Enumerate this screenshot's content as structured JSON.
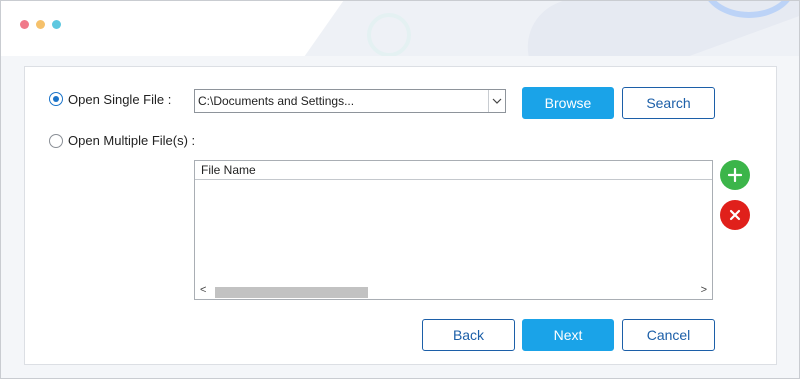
{
  "window": {
    "dots": [
      {
        "name": "close-dot",
        "color": "#f07a8a"
      },
      {
        "name": "minimize-dot",
        "color": "#f5c16b"
      },
      {
        "name": "maximize-dot",
        "color": "#5ec8e0"
      }
    ]
  },
  "single": {
    "label": "Open Single File :",
    "selected": true,
    "path_value": "C:\\Documents and Settings...",
    "browse_label": "Browse",
    "search_label": "Search"
  },
  "multiple": {
    "label": "Open Multiple File(s) :",
    "selected": false,
    "list": {
      "columns": [
        "File Name"
      ],
      "rows": [],
      "scroll_left": "<",
      "scroll_right": ">"
    }
  },
  "footer": {
    "back_label": "Back",
    "next_label": "Next",
    "cancel_label": "Cancel"
  },
  "colors": {
    "primary": "#1aa3e8",
    "outline": "#1c5fa8",
    "add": "#3cb54a",
    "remove": "#e0201b"
  }
}
